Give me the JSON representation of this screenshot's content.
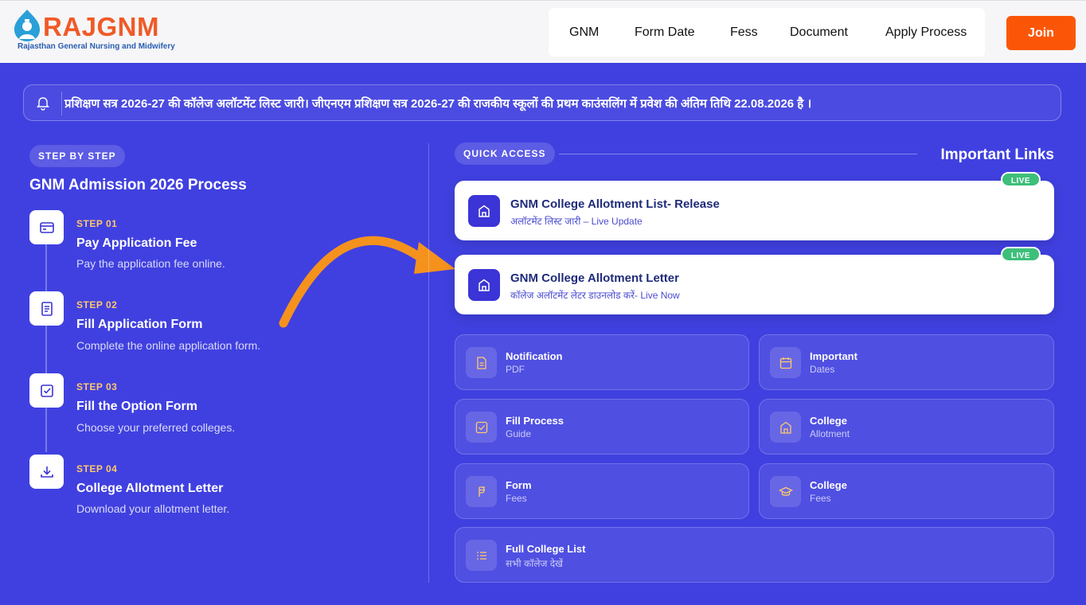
{
  "brand": {
    "name": "RAJGNM",
    "tagline": "Rajasthan General Nursing and Midwifery"
  },
  "nav": {
    "items": [
      "GNM",
      "Form Date",
      "Fess",
      "Document",
      "Apply Process"
    ],
    "join_label": "Join"
  },
  "ticker": {
    "text": "प्रशिक्षण सत्र 2026-27 की कॉलेज अलॉटमेंट लिस्ट जारी। जीएनएम प्रशिक्षण सत्र 2026-27 की राजकीय स्कूलों की प्रथम काउंसलिंग में प्रवेश की अंतिम तिथि 22.08.2026 है ।"
  },
  "steps_section": {
    "pill": "STEP BY STEP",
    "title": "GNM Admission 2026 Process",
    "steps": [
      {
        "num": "STEP 01",
        "title": "Pay Application Fee",
        "desc": "Pay the application fee online.",
        "icon": "card-icon"
      },
      {
        "num": "STEP 02",
        "title": "Fill Application Form",
        "desc": "Complete the online application form.",
        "icon": "form-icon"
      },
      {
        "num": "STEP 03",
        "title": "Fill the Option Form",
        "desc": "Choose your preferred colleges.",
        "icon": "checkbox-icon"
      },
      {
        "num": "STEP 04",
        "title": "College Allotment Letter",
        "desc": "Download your allotment letter.",
        "icon": "download-icon"
      }
    ]
  },
  "links_section": {
    "pill": "QUICK ACCESS",
    "title": "Important Links",
    "live_cards": [
      {
        "title": "GNM College Allotment List- Release",
        "subtitle": "अलॉटमेंट लिस्ट जारी – Live Update",
        "badge": "LIVE"
      },
      {
        "title": "GNM College Allotment Letter",
        "subtitle": "कॉलेज अलॉटमेंट लेटर डाउनलोड करें- Live Now",
        "badge": "LIVE"
      }
    ],
    "tiles": [
      {
        "title": "Notification",
        "sub": "PDF",
        "icon": "document-icon"
      },
      {
        "title": "Important",
        "sub": "Dates",
        "icon": "calendar-icon"
      },
      {
        "title": "Fill Process",
        "sub": "Guide",
        "icon": "checkbox-icon"
      },
      {
        "title": "College",
        "sub": "Allotment",
        "icon": "building-icon"
      },
      {
        "title": "Form",
        "sub": "Fees",
        "icon": "rupee-icon"
      },
      {
        "title": "College",
        "sub": "Fees",
        "icon": "graduation-cap-icon"
      },
      {
        "title": "Full College List",
        "sub": "सभी कॉलेज देखें",
        "icon": "list-icon"
      }
    ]
  },
  "colors": {
    "background": "#4040e0",
    "accent": "#fb5607",
    "live": "#3dbf7a"
  }
}
